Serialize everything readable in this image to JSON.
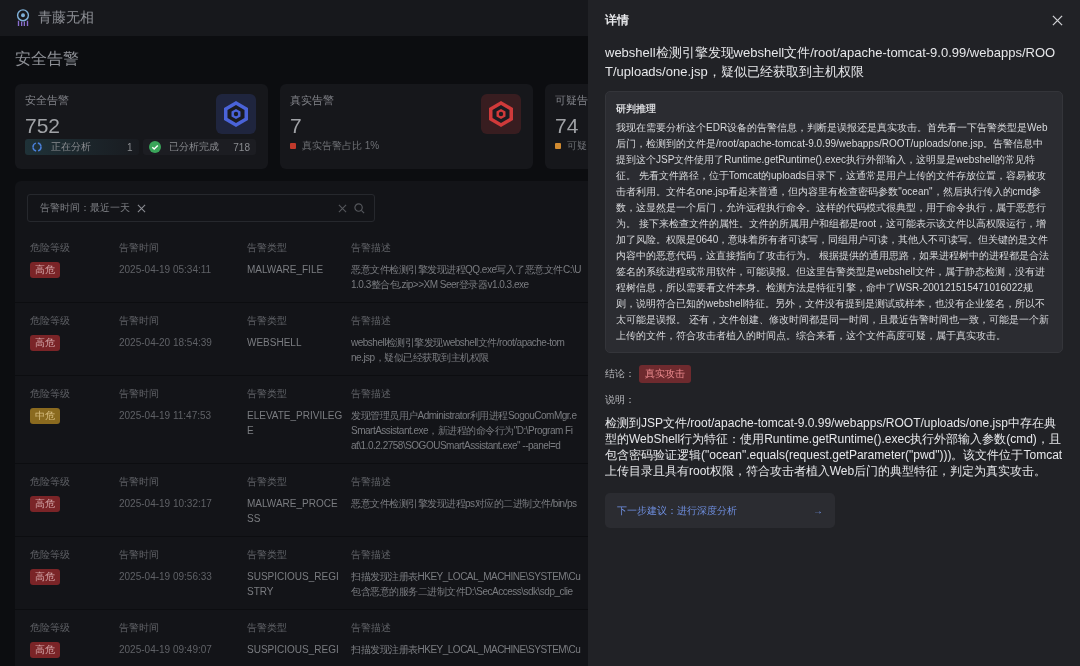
{
  "app": {
    "name": "青藤无相"
  },
  "page_title": "安全告警",
  "stat_cards": [
    {
      "title": "安全告警",
      "value": "752",
      "color": "#4a63d8",
      "kind": "pills",
      "pills": [
        {
          "label": "正在分析",
          "count": "1",
          "kind": "running"
        },
        {
          "label": "已分析完成",
          "count": "718",
          "kind": "done"
        }
      ]
    },
    {
      "title": "真实告警",
      "value": "7",
      "color": "#d03a3a",
      "kind": "legend",
      "legend": {
        "text": "真实告警占比 1%",
        "color": "#c0392b"
      }
    },
    {
      "title": "可疑告",
      "value": "74",
      "kind": "legend",
      "legend": {
        "text": "可疑",
        "color": "#d08a30"
      }
    }
  ],
  "filter": {
    "chip": "告警时间：最近一天"
  },
  "alerts": [
    {
      "field_labels": [
        "危险等级",
        "告警时间",
        "告警类型",
        "告警描述"
      ],
      "severity": {
        "text": "高危",
        "kind": "high"
      },
      "time": "2025-04-19 05:34:11",
      "type": "MALWARE_FILE",
      "description": [
        "恶意文件检测引擎发现进程QQ.exe写入了恶意文件C:\\U",
        "1.0.3整合包.zip>>XM Seer登录器v1.0.3.exe"
      ]
    },
    {
      "field_labels": [
        "危险等级",
        "告警时间",
        "告警类型",
        "告警描述"
      ],
      "severity": {
        "text": "高危",
        "kind": "high"
      },
      "time": "2025-04-20 18:54:39",
      "type": "WEBSHELL",
      "description": [
        "webshell检测引擎发现webshell文件/root/apache-tom",
        "ne.jsp，疑似已经获取到主机权限"
      ]
    },
    {
      "field_labels": [
        "危险等级",
        "告警时间",
        "告警类型",
        "告警描述"
      ],
      "severity": {
        "text": "中危",
        "kind": "medium"
      },
      "time": "2025-04-19 11:47:53",
      "type": "ELEVATE_PRIVILEGE",
      "description": [
        "发现管理员用户Administrator利用进程SogouComMgr.e",
        "SmartAssistant.exe，新进程的命令行为\"D:\\Program Fi",
        "at\\1.0.2.2758\\SOGOUSmartAssistant.exe\" --panel=d"
      ]
    },
    {
      "field_labels": [
        "危险等级",
        "告警时间",
        "告警类型",
        "告警描述"
      ],
      "severity": {
        "text": "高危",
        "kind": "high"
      },
      "time": "2025-04-19 10:32:17",
      "type": "MALWARE_PROCESS",
      "description": [
        "恶意文件检测引擎发现进程ps对应的二进制文件/bin/ps"
      ]
    },
    {
      "field_labels": [
        "危险等级",
        "告警时间",
        "告警类型",
        "告警描述"
      ],
      "severity": {
        "text": "高危",
        "kind": "high"
      },
      "time": "2025-04-19 09:56:33",
      "type": "SUSPICIOUS_REGISTRY",
      "description": [
        "扫描发现注册表HKEY_LOCAL_MACHINE\\SYSTEM\\Cu",
        "包含恶意的服务二进制文件D:\\SecAccess\\sdk\\sdp_clie"
      ]
    },
    {
      "field_labels": [
        "危险等级",
        "告警时间",
        "告警类型",
        "告警描述"
      ],
      "severity": {
        "text": "高危",
        "kind": "high"
      },
      "time": "2025-04-19 09:49:07",
      "type": "SUSPICIOUS_REGI",
      "description": [
        "扫描发现注册表HKEY_LOCAL_MACHINE\\SYSTEM\\Cu"
      ]
    }
  ],
  "drawer": {
    "title": "详情",
    "heading": "webshell检测引擎发现webshell文件/root/apache-tomcat-9.0.99/webapps/ROOT/uploads/one.jsp，疑似已经获取到主机权限",
    "reasoning": {
      "title": "研判推理",
      "text": "我现在需要分析这个EDR设备的告警信息，判断是误报还是真实攻击。首先看一下告警类型是Web后门，检测到的文件是/root/apache-tomcat-9.0.99/webapps/ROOT/uploads/one.jsp。告警信息中提到这个JSP文件使用了Runtime.getRuntime().exec执行外部输入，这明显是webshell的常见特征。 先看文件路径，位于Tomcat的uploads目录下，这通常是用户上传的文件存放位置，容易被攻击者利用。文件名one.jsp看起来普通，但内容里有检查密码参数\"ocean\"，然后执行传入的cmd参数，这显然是一个后门，允许远程执行命令。这样的代码模式很典型，用于命令执行，属于恶意行为。 接下来检查文件的属性。文件的所属用户和组都是root，这可能表示该文件以高权限运行，增加了风险。权限是0640，意味着所有者可读写，同组用户可读，其他人不可读写。但关键的是文件内容中的恶意代码，这直接指向了攻击行为。 根据提供的通用思路，如果进程树中的进程都是合法签名的系统进程或常用软件，可能误报。但这里告警类型是webshell文件，属于静态检测，没有进程树信息，所以需要看文件本身。检测方法是特征引擎，命中了WSR-200121515471016022规则，说明符合已知的webshell特征。另外，文件没有提到是测试或样本，也没有企业签名，所以不太可能是误报。 还有，文件创建、修改时间都是同一时间，且最近告警时间也一致，可能是一个新上传的文件，符合攻击者植入的时间点。综合来看，这个文件高度可疑，属于真实攻击。"
    },
    "conclusion": {
      "label": "结论：",
      "tag": "真实攻击",
      "kind": "attack"
    },
    "explanation": {
      "label": "说明：",
      "text": "检测到JSP文件/root/apache-tomcat-9.0.99/webapps/ROOT/uploads/one.jsp中存在典型的WebShell行为特征：使用Runtime.getRuntime().exec执行外部输入参数(cmd)，且包含密码验证逻辑(\"ocean\".equals(request.getParameter(\"pwd\")))。该文件位于Tomcat上传目录且具有root权限，符合攻击者植入Web后门的典型特征，判定为真实攻击。"
    },
    "next_step": {
      "text": "下一步建议：进行深度分析",
      "arrow": "→"
    }
  }
}
